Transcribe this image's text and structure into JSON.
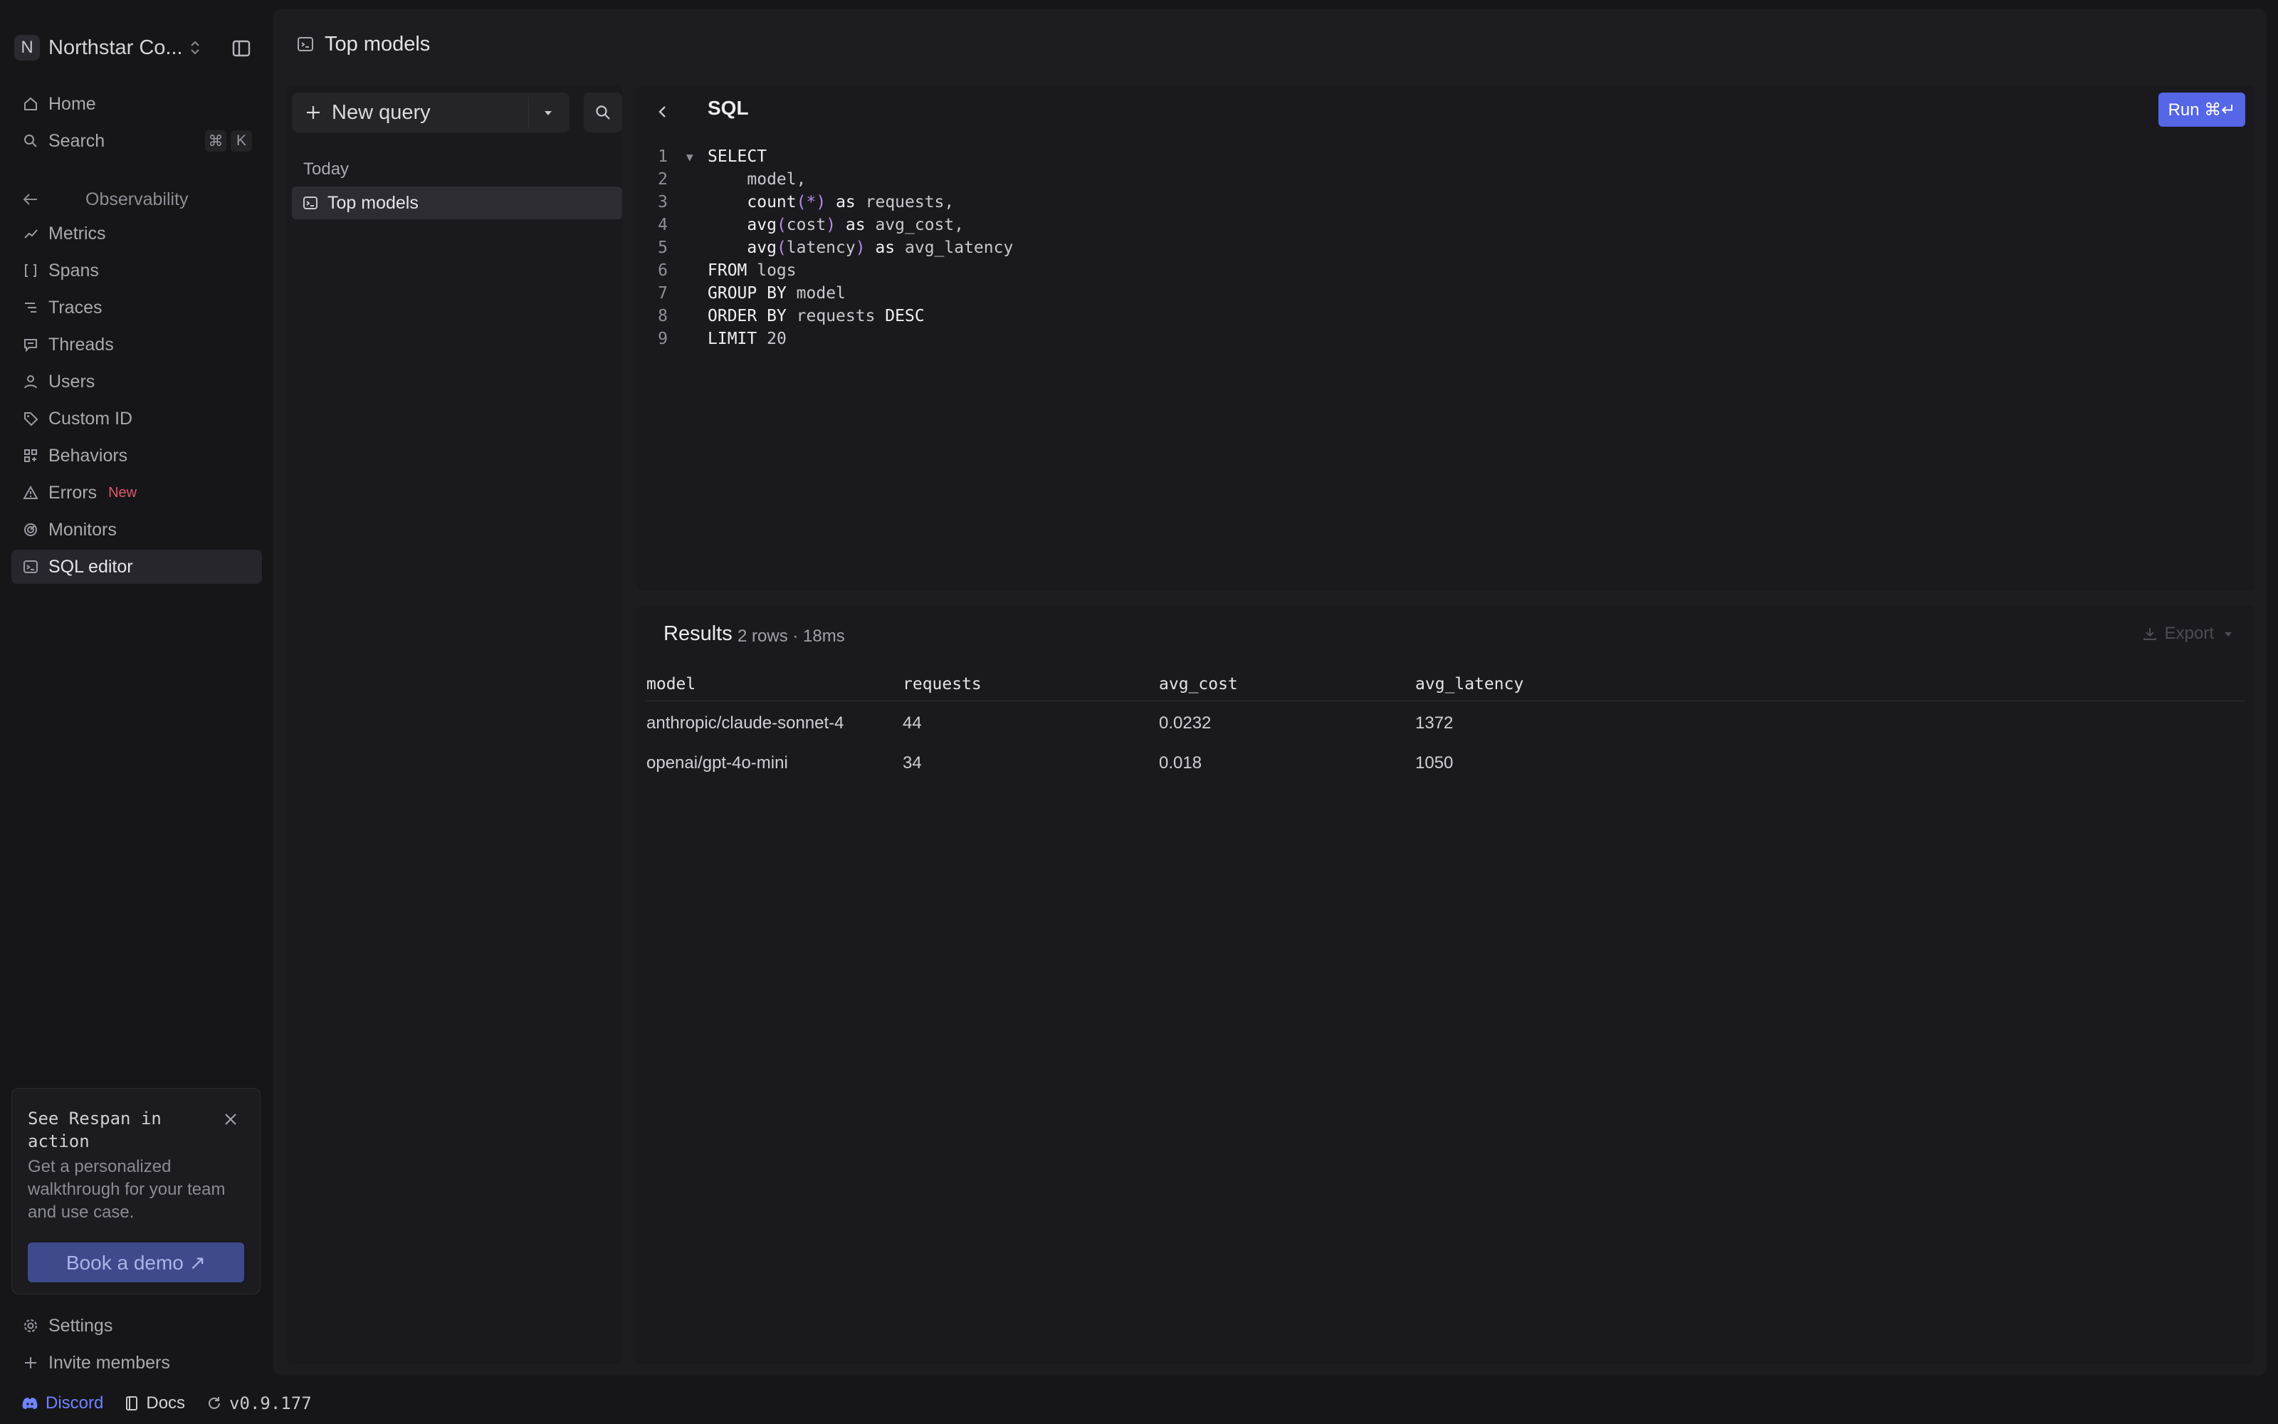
{
  "workspace": {
    "initial": "N",
    "name": "Northstar Co..."
  },
  "nav": {
    "home": "Home",
    "search": "Search",
    "search_shortcut_1": "⌘",
    "search_shortcut_2": "K",
    "section": "Observability",
    "items": [
      {
        "label": "Metrics",
        "icon": "chart-line-icon"
      },
      {
        "label": "Spans",
        "icon": "brackets-icon"
      },
      {
        "label": "Traces",
        "icon": "list-tree-icon"
      },
      {
        "label": "Threads",
        "icon": "message-icon"
      },
      {
        "label": "Users",
        "icon": "user-icon"
      },
      {
        "label": "Custom ID",
        "icon": "tag-icon"
      },
      {
        "label": "Behaviors",
        "icon": "grid-plus-icon"
      },
      {
        "label": "Errors",
        "icon": "warning-icon",
        "badge": "New"
      },
      {
        "label": "Monitors",
        "icon": "radar-icon"
      },
      {
        "label": "SQL editor",
        "icon": "terminal-icon",
        "active": true
      }
    ]
  },
  "promo": {
    "title": "See Respan in action",
    "body": "Get a personalized walkthrough for your team and use case.",
    "cta": "Book a demo ↗"
  },
  "footer": {
    "settings": "Settings",
    "invite": "Invite members"
  },
  "bottombar": {
    "discord": "Discord",
    "docs": "Docs",
    "version": "v0.9.177"
  },
  "page": {
    "title": "Top models"
  },
  "queries": {
    "new_label": "New query",
    "group": "Today",
    "items": [
      {
        "label": "Top models",
        "selected": true
      }
    ]
  },
  "editor": {
    "title": "SQL",
    "run_label": "Run ⌘↵",
    "lines": [
      "SELECT",
      "    model,",
      "    count(*) as requests,",
      "    avg(cost) as avg_cost,",
      "    avg(latency) as avg_latency",
      "FROM logs",
      "GROUP BY model",
      "ORDER BY requests DESC",
      "LIMIT 20"
    ]
  },
  "results": {
    "title": "Results",
    "meta": "2 rows · 18ms",
    "export_label": "Export",
    "columns": [
      "model",
      "requests",
      "avg_cost",
      "avg_latency"
    ],
    "rows": [
      [
        "anthropic/claude-sonnet-4",
        "44",
        "0.0232",
        "1372"
      ],
      [
        "openai/gpt-4o-mini",
        "34",
        "0.018",
        "1050"
      ]
    ]
  },
  "colors": {
    "accent": "#5566e6",
    "badge_new": "#e05a6a",
    "discord": "#6f84ff",
    "background": "#161619",
    "panel": "#1a1a1e"
  }
}
